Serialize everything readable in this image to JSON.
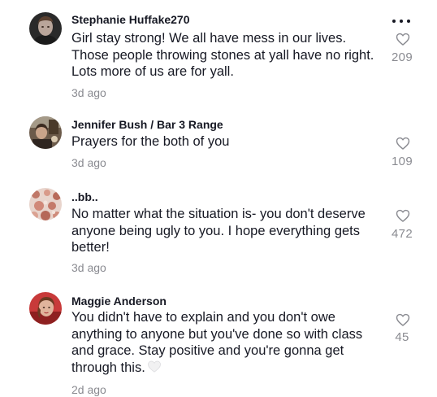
{
  "comments": [
    {
      "username": "Stephanie Huffake270",
      "text": "Girl stay strong! We all have mess in our lives. Those people throwing stones at yall have no right. Lots more of us are for yall.",
      "age": "3d ago",
      "likes": "209"
    },
    {
      "username": "Jennifer Bush / Bar 3 Range",
      "text": "Prayers for the both of you",
      "age": "3d ago",
      "likes": "109"
    },
    {
      "username": "..bb..",
      "text": "No matter what the situation is- you don't deserve anyone being ugly to you. I hope everything gets better!",
      "age": "3d ago",
      "likes": "472"
    },
    {
      "username": "Maggie Anderson",
      "text": "You didn't have to explain and you don't owe anything to anyone but you've done so with class and grace. Stay positive and you're gonna get through this.",
      "age": "2d ago",
      "likes": "45"
    }
  ],
  "icons": {
    "more": "more-dots-icon",
    "like": "heart-outline-icon",
    "emoji": "white-heart-emoji"
  },
  "colors": {
    "text": "#161823",
    "secondary": "#8a8b91"
  }
}
